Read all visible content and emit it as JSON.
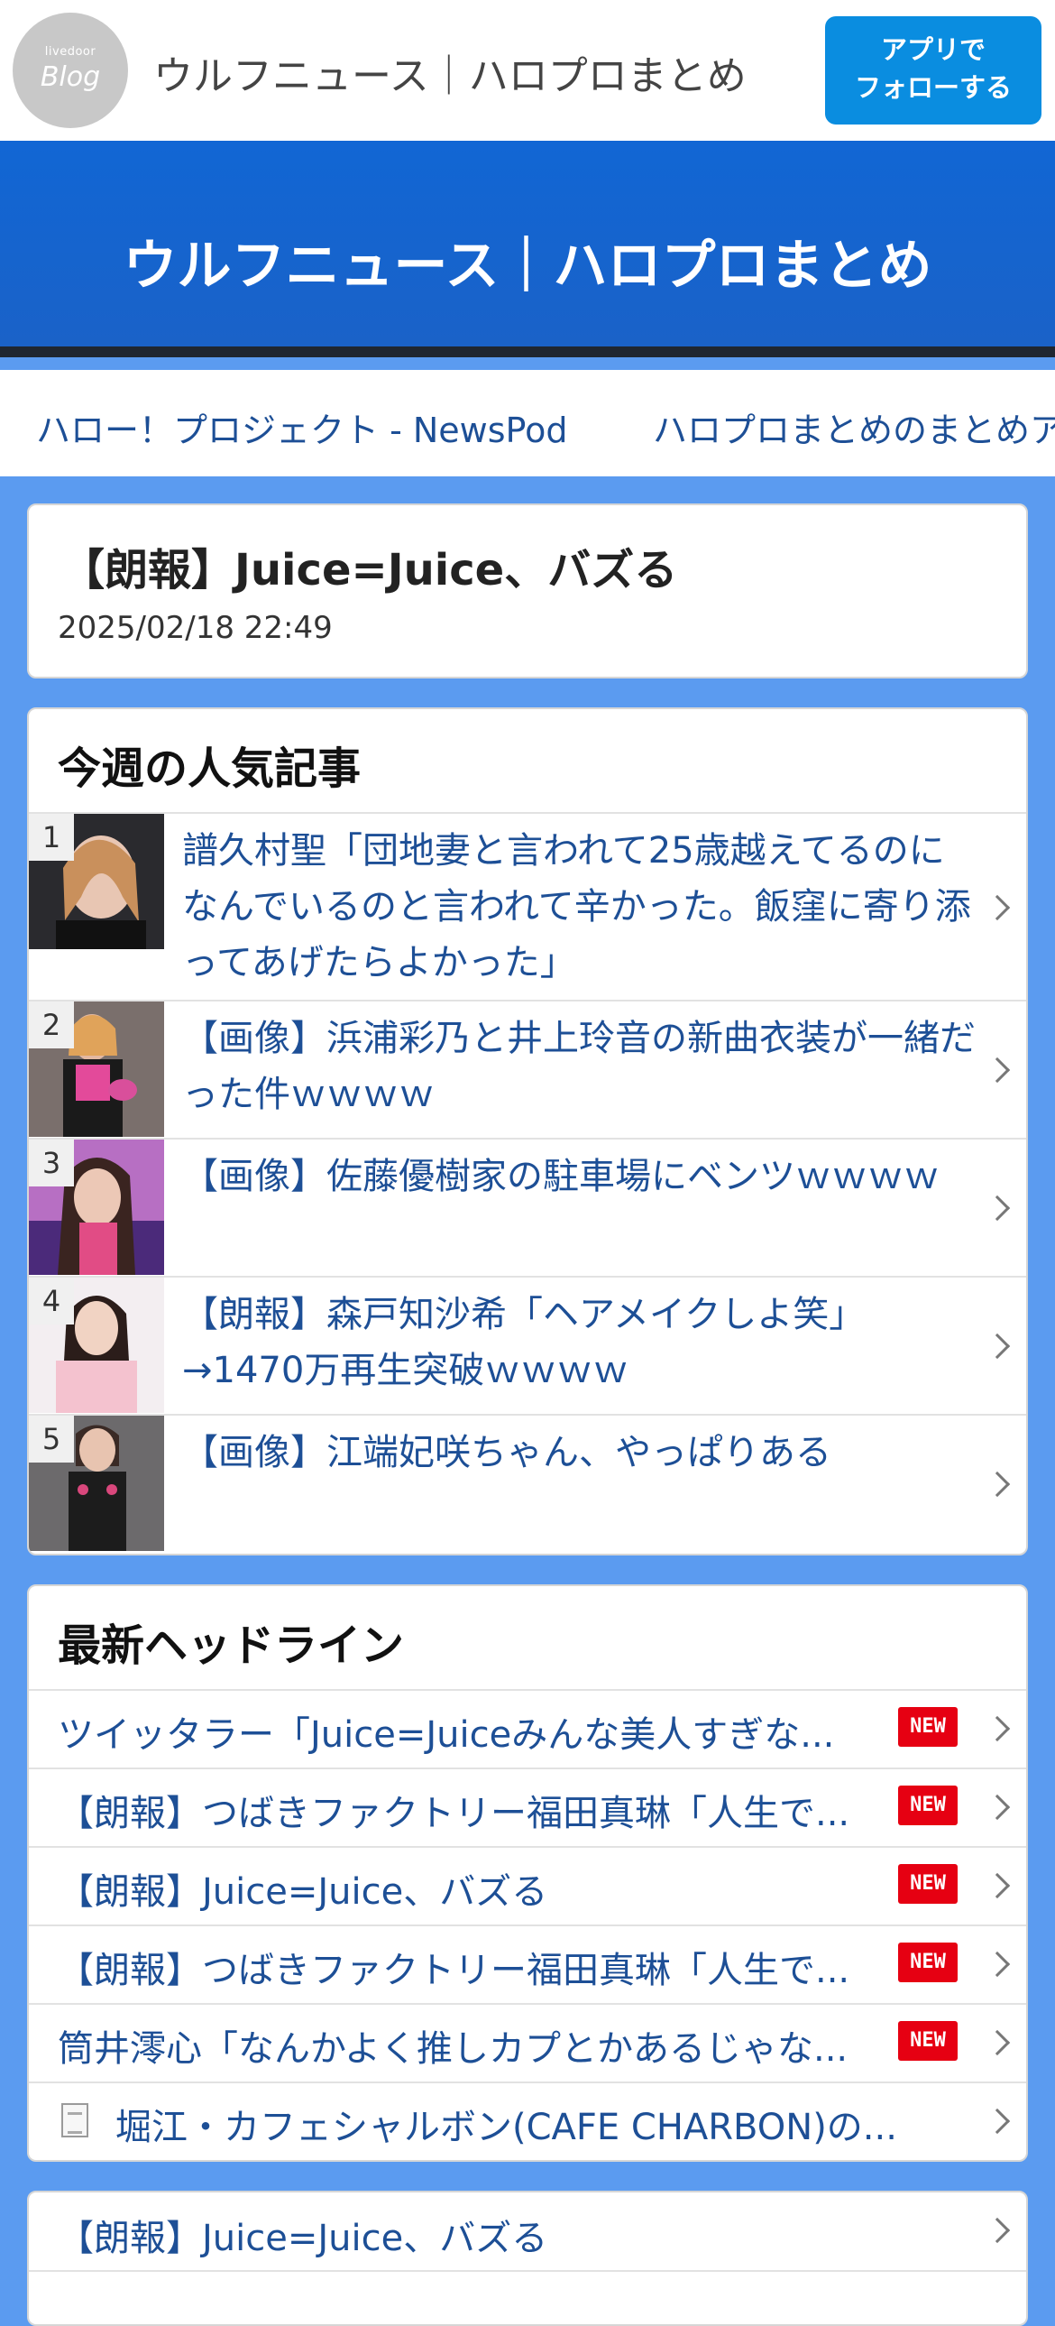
{
  "header": {
    "logo_small": "livedoor",
    "logo_big": "Blog",
    "site_name": "ウルフニュース｜ハロプロまとめ",
    "follow_line1": "アプリで",
    "follow_line2": "フォローする"
  },
  "hero": {
    "title": "ウルフニュース｜ハロプロまとめ"
  },
  "nav": {
    "items": [
      "ハロー！プロジェクト - NewsPod",
      "ハロプロまとめのまとめア"
    ]
  },
  "article": {
    "title": "【朗報】Juice=Juice、バズる",
    "date": "2025/02/18 22:49"
  },
  "ranking": {
    "title": "今週の人気記事",
    "items": [
      {
        "rank": "1",
        "title": "譜久村聖「団地妻と言われて25歳越えてるのになんでいるのと言われて辛かった。飯窪に寄り添ってあげたらよかった」"
      },
      {
        "rank": "2",
        "title": "【画像】浜浦彩乃と井上玲音の新曲衣装が一緒だった件ｗｗｗｗ"
      },
      {
        "rank": "3",
        "title": "【画像】佐藤優樹家の駐車場にベンツｗｗｗｗ"
      },
      {
        "rank": "4",
        "title": "【朗報】森戸知沙希「ヘアメイクしよ笑」→1470万再生突破ｗｗｗｗ"
      },
      {
        "rank": "5",
        "title": "【画像】江端妃咲ちゃん、やっぱりある"
      }
    ]
  },
  "headlines": {
    "title": "最新ヘッドライン",
    "new_label": "NEW",
    "items": [
      {
        "title": "ツイッタラー「Juice=Juiceみんな美人すぎな..."
      },
      {
        "title": "【朗報】つばきファクトリー福田真琳「人生で..."
      },
      {
        "title": "【朗報】Juice=Juice、バズる"
      },
      {
        "title": "【朗報】つばきファクトリー福田真琳「人生で..."
      },
      {
        "title": "筒井澪心「なんかよく推しカプとかあるじゃな..."
      },
      {
        "title": "堀江・カフェシャルボン(CAFE CHARBON)の..."
      }
    ]
  },
  "bottom": {
    "item": "【朗報】Juice=Juice、バズる"
  },
  "colors": {
    "accent": "#0a8de0",
    "hero": "#1166d4",
    "page_bg": "#5b9bf0",
    "link": "#1d4f96",
    "new_badge": "#e60012"
  },
  "icons": [
    "chevron-right-icon",
    "document-icon"
  ]
}
